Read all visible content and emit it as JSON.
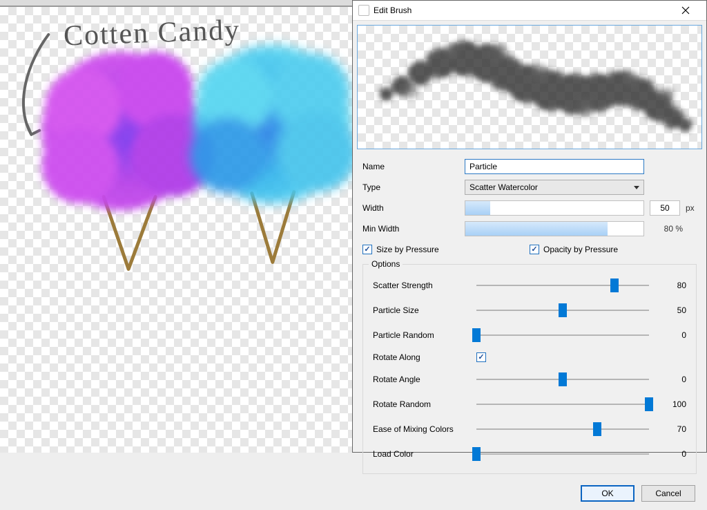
{
  "canvas": {
    "handwritten_text": "Cotten Candy"
  },
  "dialog": {
    "title": "Edit Brush",
    "name_label": "Name",
    "name_value": "Particle",
    "type_label": "Type",
    "type_value": "Scatter Watercolor",
    "width_label": "Width",
    "width_value": "50",
    "width_unit": "px",
    "width_fill_pct": 14,
    "minwidth_label": "Min Width",
    "minwidth_value": "80 %",
    "minwidth_fill_pct": 80,
    "size_by_pressure": "Size by Pressure",
    "opacity_by_pressure": "Opacity by Pressure",
    "options_label": "Options",
    "sliders": {
      "scatter_strength": {
        "label": "Scatter Strength",
        "value": 80,
        "pos": 80
      },
      "particle_size": {
        "label": "Particle Size",
        "value": 50,
        "pos": 50
      },
      "particle_random": {
        "label": "Particle Random",
        "value": 0,
        "pos": 0
      },
      "rotate_along": {
        "label": "Rotate Along"
      },
      "rotate_angle": {
        "label": "Rotate Angle",
        "value": 0,
        "pos": 50
      },
      "rotate_random": {
        "label": "Rotate Random",
        "value": 100,
        "pos": 100
      },
      "ease_mixing": {
        "label": "Ease of Mixing Colors",
        "value": 70,
        "pos": 70
      },
      "load_color": {
        "label": "Load Color",
        "value": 0,
        "pos": 0
      }
    },
    "buttons": {
      "ok": "OK",
      "cancel": "Cancel"
    }
  }
}
